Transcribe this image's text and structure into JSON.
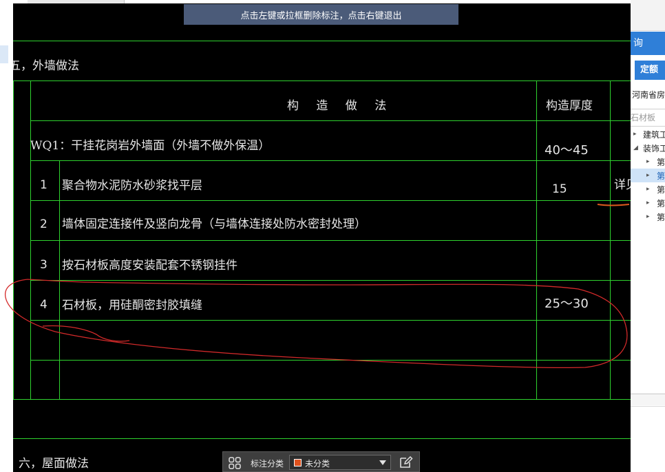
{
  "hint_banner": "点击左键或拉框删除标注，点击右键退出",
  "cad": {
    "section5_title": "五，外墙做法",
    "table_header_method": "构 造 做 法",
    "table_header_thickness": "构造厚度",
    "wq1_title": "WQ1：干挂花岗岩外墙面（外墙不做外保温）",
    "wq1_thickness": "40～45",
    "rows": [
      {
        "num": "1",
        "text": "聚合物水泥防水砂浆找平层",
        "thickness": "15"
      },
      {
        "num": "2",
        "text": "墙体固定连接件及竖向龙骨（与墙体连接处防水密封处理）",
        "thickness": ""
      },
      {
        "num": "3",
        "text": "按石材板高度安装配套不锈钢挂件",
        "thickness": ""
      },
      {
        "num": "4",
        "text": "石材板，用硅酮密封胶填缝",
        "thickness": "25～30"
      }
    ],
    "side_note": "详见",
    "section6_title": "六，屋面做法"
  },
  "right_panel": {
    "query_label": "询",
    "quota_button": "定额",
    "province_text": "河南省房屋",
    "search_value": "石材板",
    "tree": [
      {
        "label": "建筑工",
        "level": 0,
        "selected": false
      },
      {
        "label": "装饰工",
        "level": 0,
        "selected": false
      },
      {
        "label": "第",
        "level": 1,
        "selected": false
      },
      {
        "label": "第",
        "level": 1,
        "selected": true
      },
      {
        "label": "第",
        "level": 1,
        "selected": false
      },
      {
        "label": "第",
        "level": 1,
        "selected": false
      },
      {
        "label": "第",
        "level": 1,
        "selected": false
      }
    ]
  },
  "toolbar": {
    "category_label": "标注分类",
    "category_value": "未分类",
    "swatch_color": "#e0521e"
  },
  "colors": {
    "cad_line": "#2fd42f",
    "annotation": "#d42a2a",
    "accent": "#2f7fd8"
  }
}
